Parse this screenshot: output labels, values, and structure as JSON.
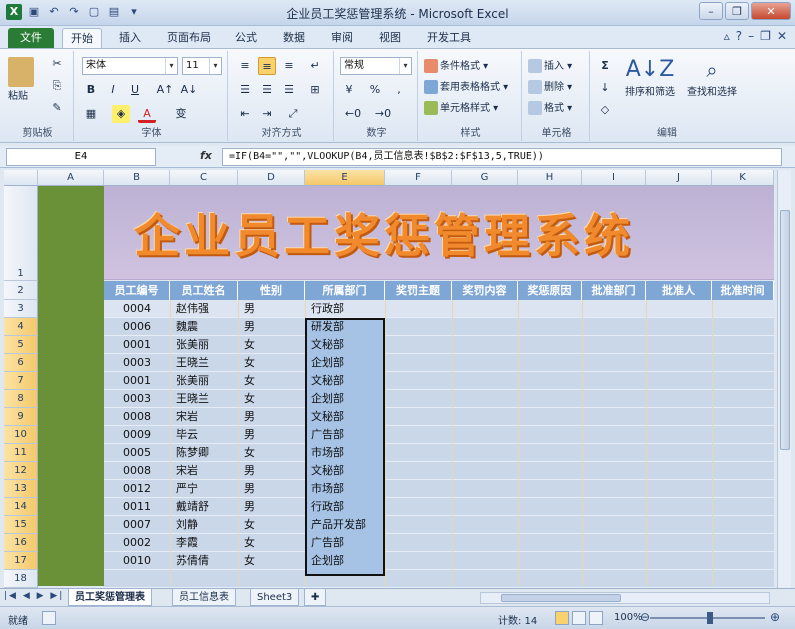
{
  "window": {
    "title": "企业员工奖惩管理系统 - Microsoft Excel"
  },
  "tabs": [
    "文件",
    "开始",
    "插入",
    "页面布局",
    "公式",
    "数据",
    "审阅",
    "视图",
    "开发工具"
  ],
  "ribbon": {
    "clipboard": {
      "paste": "粘贴",
      "label": "剪贴板"
    },
    "font": {
      "name": "宋体",
      "size": "11",
      "label": "字体",
      "bold": "B",
      "italic": "I",
      "underline": "U",
      "color_letter": "A",
      "phonetic": "变"
    },
    "alignment": {
      "label": "对齐方式"
    },
    "number": {
      "format": "常规",
      "percent": "%",
      "comma": ",",
      "label": "数字"
    },
    "styles": {
      "conditional": "条件格式",
      "table": "套用表格格式",
      "cell": "单元格样式",
      "label": "样式"
    },
    "cells": {
      "insert": "插入",
      "delete": "删除",
      "format": "格式",
      "label": "单元格"
    },
    "editing": {
      "sigma": "Σ",
      "sort": "排序和筛选",
      "find": "查找和选择",
      "label": "编辑"
    }
  },
  "formula_bar": {
    "name_box": "E4",
    "fx": "fx",
    "formula": "=IF(B4=\"\",\"\",VLOOKUP(B4,员工信息表!$B$2:$F$13,5,TRUE))"
  },
  "columns": [
    "A",
    "B",
    "C",
    "D",
    "E",
    "F",
    "G",
    "H",
    "I",
    "J",
    "K"
  ],
  "selected_column": "E",
  "rows": [
    "1",
    "2",
    "3",
    "4",
    "5",
    "6",
    "7",
    "8",
    "9",
    "10",
    "11",
    "12",
    "13",
    "14",
    "15",
    "16",
    "17",
    "18"
  ],
  "banner": "企业员工奖惩管理系统",
  "headers": [
    "员工编号",
    "员工姓名",
    "性别",
    "所属部门",
    "奖罚主题",
    "奖罚内容",
    "奖惩原因",
    "批准部门",
    "批准人",
    "批准时间"
  ],
  "records": [
    {
      "id": "0004",
      "name": "赵伟强",
      "gender": "男",
      "dept": "行政部"
    },
    {
      "id": "0006",
      "name": "魏震",
      "gender": "男",
      "dept": "研发部"
    },
    {
      "id": "0001",
      "name": "张美丽",
      "gender": "女",
      "dept": "文秘部"
    },
    {
      "id": "0003",
      "name": "王晓兰",
      "gender": "女",
      "dept": "企划部"
    },
    {
      "id": "0001",
      "name": "张美丽",
      "gender": "女",
      "dept": "文秘部"
    },
    {
      "id": "0003",
      "name": "王晓兰",
      "gender": "女",
      "dept": "企划部"
    },
    {
      "id": "0008",
      "name": "宋岩",
      "gender": "男",
      "dept": "文秘部"
    },
    {
      "id": "0009",
      "name": "毕云",
      "gender": "男",
      "dept": "广告部"
    },
    {
      "id": "0005",
      "name": "陈梦卿",
      "gender": "女",
      "dept": "市场部"
    },
    {
      "id": "0008",
      "name": "宋岩",
      "gender": "男",
      "dept": "文秘部"
    },
    {
      "id": "0012",
      "name": "严宁",
      "gender": "男",
      "dept": "市场部"
    },
    {
      "id": "0011",
      "name": "戴靖舒",
      "gender": "男",
      "dept": "行政部"
    },
    {
      "id": "0007",
      "name": "刘静",
      "gender": "女",
      "dept": "产品开发部"
    },
    {
      "id": "0002",
      "name": "李霞",
      "gender": "女",
      "dept": "广告部"
    },
    {
      "id": "0010",
      "name": "苏倩倩",
      "gender": "女",
      "dept": "企划部"
    }
  ],
  "sheets": [
    "员工奖惩管理表",
    "员工信息表",
    "Sheet3"
  ],
  "active_sheet": "员工奖惩管理表",
  "status": {
    "ready": "就绪",
    "count": "计数: 14",
    "zoom": "100%"
  }
}
